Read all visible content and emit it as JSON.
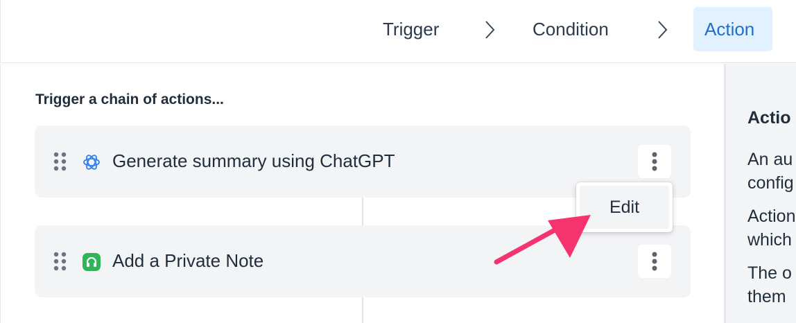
{
  "stepper": {
    "steps": [
      {
        "label": "Trigger",
        "active": false
      },
      {
        "label": "Condition",
        "active": false
      },
      {
        "label": "Action",
        "active": true
      }
    ]
  },
  "main": {
    "section_title": "Trigger a chain of actions...",
    "actions": [
      {
        "label": "Generate summary using ChatGPT",
        "icon": "chatgpt-icon",
        "icon_color": "#2f80ed"
      },
      {
        "label": "Add a Private Note",
        "icon": "private-note-icon",
        "icon_color": "#2fb45a"
      }
    ],
    "context_menu": {
      "items": [
        "Edit"
      ]
    }
  },
  "help_panel": {
    "title": "Actio",
    "lines": [
      "An au",
      "config",
      "Action",
      "which",
      "The o",
      "them"
    ]
  },
  "colors": {
    "accent": "#1a6fcf",
    "active_step_bg": "#e3f0fd",
    "annotation_arrow": "#f5336e"
  }
}
